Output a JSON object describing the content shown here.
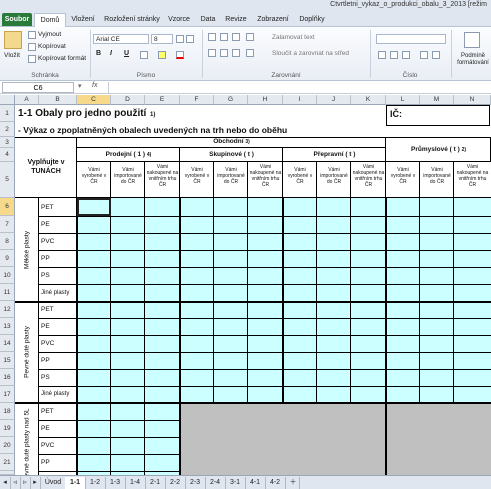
{
  "window": {
    "title": "Ctvrtletni_vykaz_o_produkci_obalu_3_2013 [režim"
  },
  "ribbon_tabs": [
    "Soubor",
    "Domů",
    "Vložení",
    "Rozložení stránky",
    "Vzorce",
    "Data",
    "Revize",
    "Zobrazení",
    "Doplňky"
  ],
  "ribbon": {
    "paste_label": "Vložit",
    "cut_label": "Vyjmout",
    "copy_label": "Kopírovat",
    "format_painter_label": "Kopírovat formát",
    "clipboard_group": "Schránka",
    "font_name": "Arial CE",
    "font_size": "8",
    "bold": "B",
    "italic": "I",
    "underline": "U",
    "font_group": "Písmo",
    "wrap_text": "Zalamovat text",
    "merge_center": "Sloučit a zarovnat na střed",
    "align_group": "Zarovnání",
    "number_group": "Číslo",
    "cond_format": "Podmíně formátování"
  },
  "formula_bar": {
    "name_box": "C6",
    "fx": "fx",
    "value": ""
  },
  "columns": [
    "A",
    "B",
    "C",
    "D",
    "E",
    "F",
    "G",
    "H",
    "I",
    "J",
    "K",
    "L",
    "M",
    "N"
  ],
  "rows": [
    "1",
    "2",
    "3",
    "4",
    "5",
    "6",
    "7",
    "8",
    "9",
    "10",
    "11",
    "12",
    "13",
    "14",
    "15",
    "16",
    "17",
    "18",
    "19",
    "20",
    "21",
    "22"
  ],
  "sheet": {
    "title": "1-1 Obaly pro jedno použití",
    "title_note": "1)",
    "subtitle": "- Výkaz o zpoplatněných obalech uvedených na trh nebo do oběhu",
    "ic_label": "IČ:",
    "left_header": "Vyplňujte v TUNÁCH",
    "obchodni": "Obchodní",
    "obchodni_note": "3)",
    "prodejni": "Prodejní ( 1 )",
    "prodejni_note": "4)",
    "skupinove": "Skupinové ( t )",
    "prepravni": "Přepravní ( t )",
    "prumyslove": "Průmyslové ( t )",
    "prumyslove_note": "2)",
    "sub_vyrobene": "Vámi vyrobené v ČR",
    "sub_importovane": "Vámi importované do ČR",
    "sub_nakoupene": "Vámi nakoupené na vnitřním trhu ČR",
    "group1": "Měkké plasty",
    "group2": "Pevné duté plasty",
    "group3": "Pevné duté plasty nad 5L",
    "materials1": [
      "PET",
      "PE",
      "PVC",
      "PP",
      "PS",
      "Jiné plasty"
    ],
    "materials2": [
      "PET",
      "PE",
      "PVC",
      "PP",
      "PS",
      "Jiné plasty"
    ],
    "materials3": [
      "PET",
      "PE",
      "PVC",
      "PP"
    ]
  },
  "sheet_tabs": [
    "Úvod",
    "1-1",
    "1-2",
    "1-3",
    "1-4",
    "2-1",
    "2-2",
    "2-3",
    "2-4",
    "3-1",
    "4-1",
    "4-2"
  ],
  "active_sheet": "1-1",
  "colors": {
    "input_fill": "#ccffff",
    "disabled_fill": "#c0c0c0",
    "selection_header": "#f7d98c",
    "file_tab": "#2a7a3a"
  }
}
